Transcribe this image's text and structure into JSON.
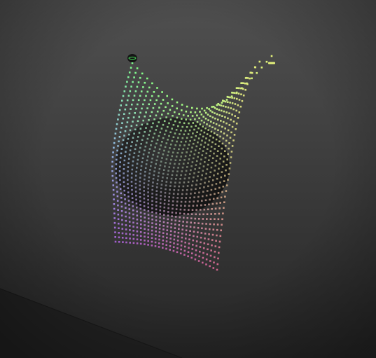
{
  "scene": {
    "background_top": "#505050",
    "background_bottom": "#262626",
    "floor_color": "#222222",
    "sphere_color": "#1e1e1e",
    "pin_color": "#141414",
    "pin_ring_color": "#3fbf4f",
    "particle_colors": {
      "top_left": "#7dff8a",
      "top_right": "#e3f07a",
      "middle_left": "#9fc7ff",
      "middle_right": "#d9d184",
      "bottom_left": "#c46cff",
      "bottom_right": "#ff74aa"
    },
    "cloth": {
      "columns": 28,
      "rows": 38
    }
  }
}
